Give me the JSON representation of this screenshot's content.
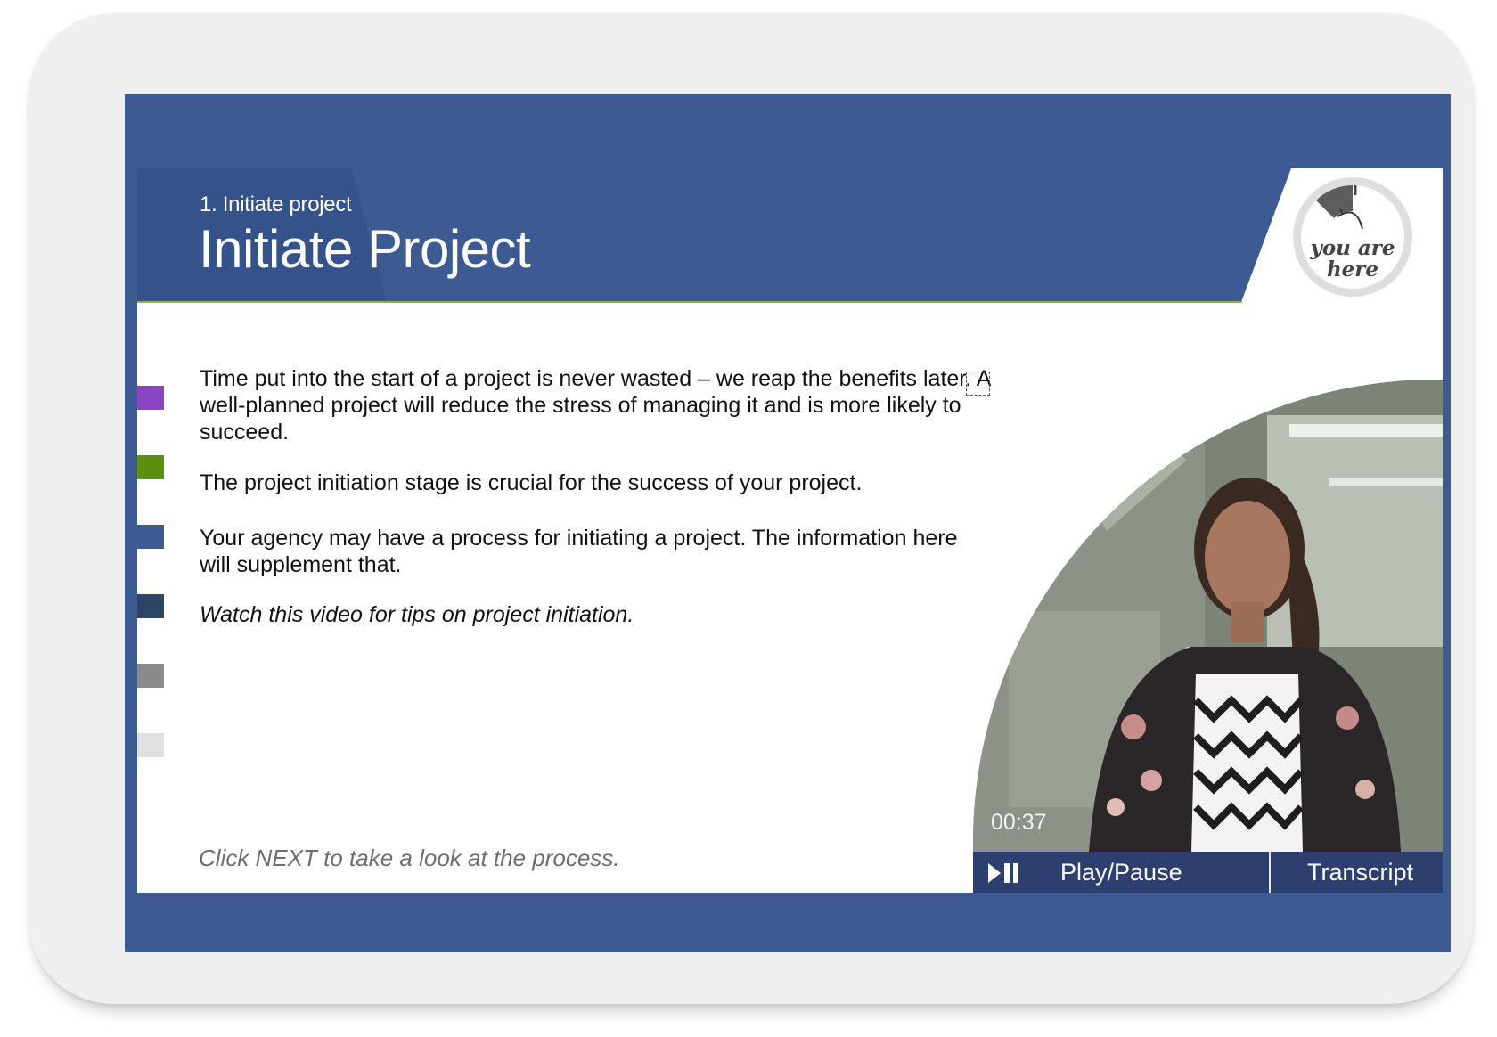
{
  "header": {
    "breadcrumb": "1. Initiate project",
    "title": "Initiate Project",
    "badge": "you are\nhere"
  },
  "tabs": [
    {
      "color": "#8a44c4"
    },
    {
      "color": "#5b8e11"
    },
    {
      "color": "#3d5a92"
    },
    {
      "color": "#2d4666"
    },
    {
      "color": "#8a8a8a"
    },
    {
      "color": "#e0e0e0"
    }
  ],
  "content": {
    "paragraphs": [
      "Time put into the start of a project is never wasted – we reap the benefits later.  A well-planned project will reduce the stress of managing it and is more likely to succeed.",
      "The project initiation stage is crucial for the success of your project.",
      "Your agency may have a process for initiating a project. The information here will supplement that.",
      "Watch this video for tips on project initiation."
    ],
    "hint": "Click NEXT to take a look at the process."
  },
  "video": {
    "timestamp": "00:37",
    "play_label": "Play/Pause",
    "transcript_label": "Transcript"
  }
}
